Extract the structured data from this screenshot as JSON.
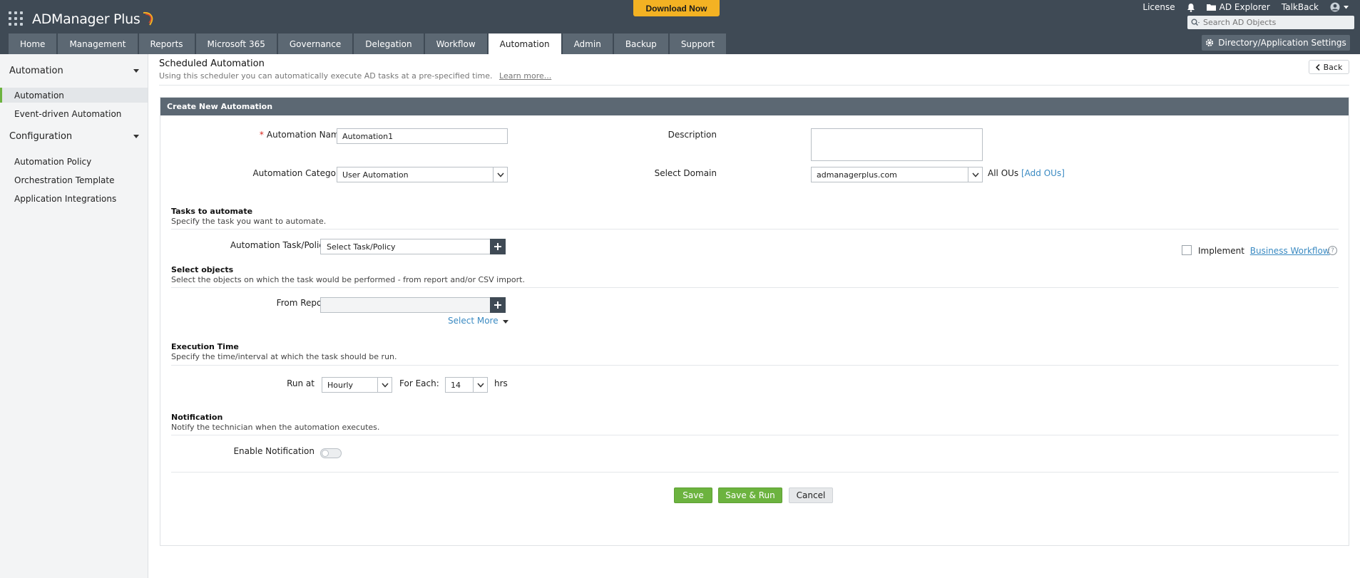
{
  "header": {
    "logo_text": "ADManager Plus",
    "download_label": "Download Now",
    "top_links": [
      "License",
      "AD Explorer",
      "TalkBack"
    ],
    "search_placeholder": "Search AD Objects",
    "settings_label": "Directory/Application Settings"
  },
  "nav": {
    "tabs": [
      {
        "label": "Home"
      },
      {
        "label": "Management"
      },
      {
        "label": "Reports"
      },
      {
        "label": "Microsoft 365"
      },
      {
        "label": "Governance"
      },
      {
        "label": "Delegation"
      },
      {
        "label": "Workflow"
      },
      {
        "label": "Automation",
        "active": true
      },
      {
        "label": "Admin"
      },
      {
        "label": "Backup"
      },
      {
        "label": "Support"
      }
    ]
  },
  "sidebar": {
    "section1_title": "Automation",
    "section1_items": [
      "Automation",
      "Event-driven Automation"
    ],
    "section2_title": "Configuration",
    "section2_items": [
      "Automation Policy",
      "Orchestration Template",
      "Application Integrations"
    ]
  },
  "page": {
    "title": "Scheduled Automation",
    "subtitle": "Using this scheduler you can automatically execute AD tasks at a pre-specified time.",
    "learn_more": "Learn more...",
    "back_label": "Back"
  },
  "form": {
    "panel_title": "Create New Automation",
    "name_label": "Automation Name",
    "name_value": "Automation1",
    "description_label": "Description",
    "category_label": "Automation Category",
    "category_value": "User Automation",
    "domain_label": "Select Domain",
    "domain_value": "admanagerplus.com",
    "all_ous": "All OUs",
    "add_ous": "[Add OUs]",
    "tasks": {
      "title": "Tasks to automate",
      "desc": "Specify the task you want to automate.",
      "task_label": "Automation Task/Policy",
      "task_value": "Select Task/Policy",
      "implement_label": "Implement",
      "workflow_link": "Business Workflow"
    },
    "objects": {
      "title": "Select objects",
      "desc": "Select the objects on which the task would be performed - from report and/or CSV import.",
      "report_label": "From Report",
      "select_more": "Select More"
    },
    "execution": {
      "title": "Execution Time",
      "desc": "Specify the time/interval at which the task should be run.",
      "run_at_label": "Run at",
      "run_at_value": "Hourly",
      "for_each_label": "For Each:",
      "for_each_value": "14",
      "unit": "hrs"
    },
    "notification": {
      "title": "Notification",
      "desc": "Notify the technician when the automation executes.",
      "enable_label": "Enable Notification"
    },
    "buttons": {
      "save": "Save",
      "save_run": "Save & Run",
      "cancel": "Cancel"
    }
  }
}
